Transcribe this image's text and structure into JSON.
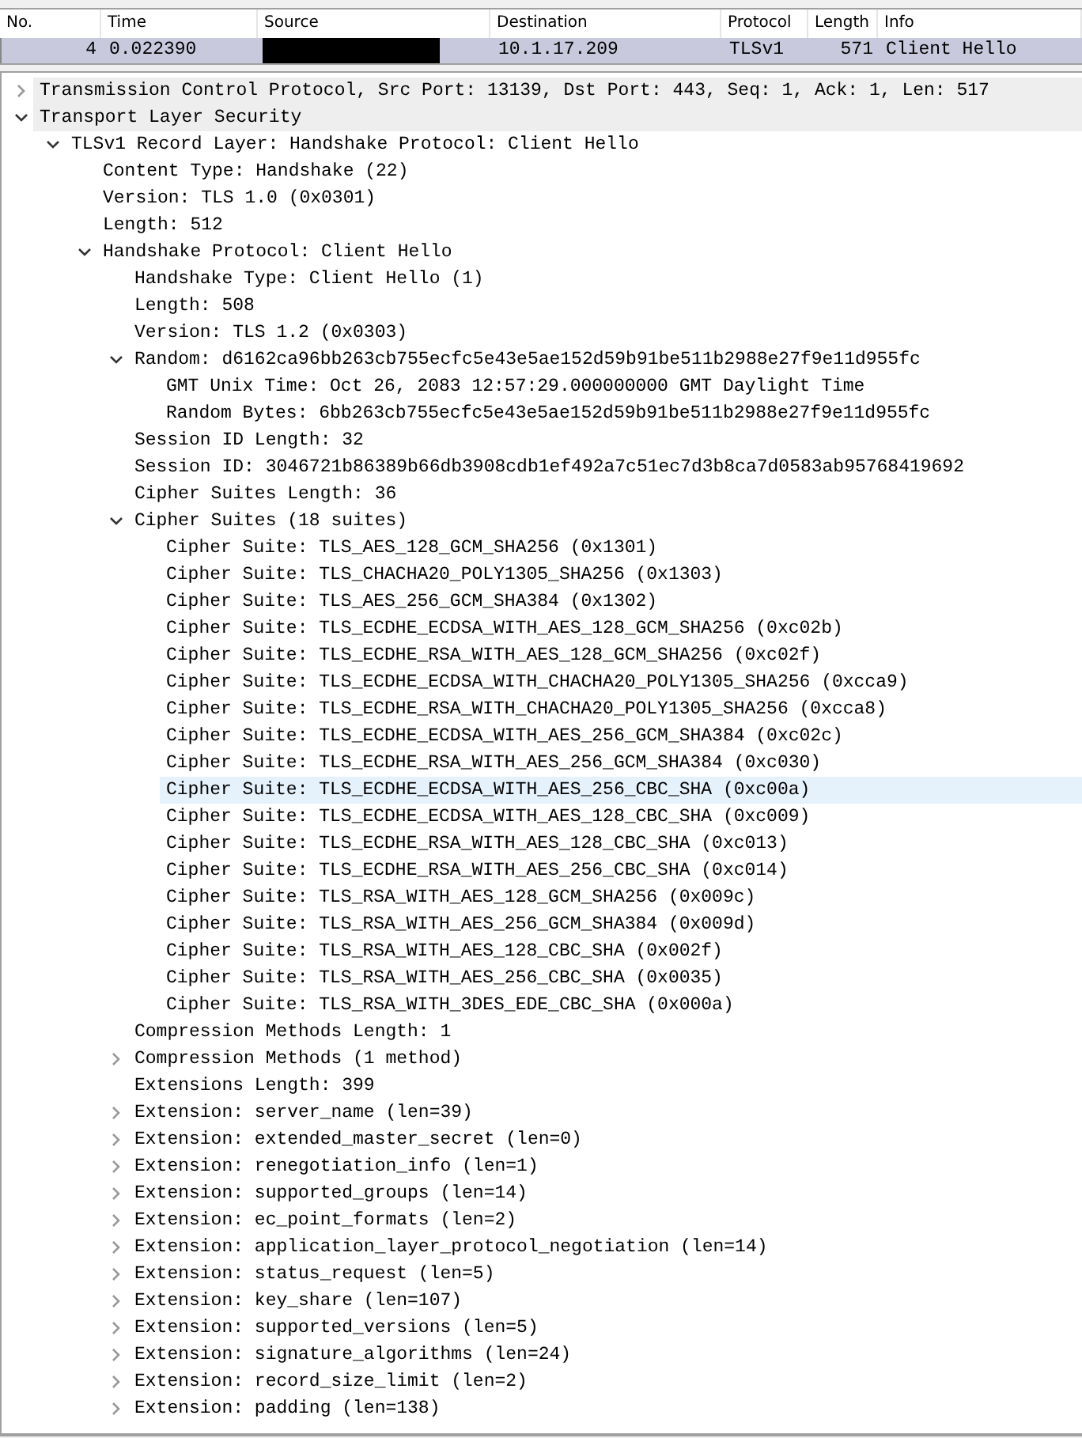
{
  "packet_list": {
    "columns": [
      "No.",
      "Time",
      "Source",
      "Destination",
      "Protocol",
      "Length",
      "Info"
    ],
    "rows": [
      {
        "selected": true,
        "number": "4",
        "time": "0.022390",
        "source_redacted": true,
        "destination": "10.1.17.209",
        "protocol": "TLSv1",
        "length": "571",
        "info": "Client Hello"
      }
    ]
  },
  "details": [
    {
      "label": "Transmission Control Protocol, Src Port: 13139, Dst Port: 443, Seq: 1, Ack: 1, Len: 517",
      "expanded": false,
      "shaded": true
    },
    {
      "label": "Transport Layer Security",
      "expanded": true,
      "shaded": true,
      "children": [
        {
          "label": "TLSv1 Record Layer: Handshake Protocol: Client Hello",
          "expanded": true,
          "children": [
            {
              "label": "Content Type: Handshake (22)"
            },
            {
              "label": "Version: TLS 1.0 (0x0301)"
            },
            {
              "label": "Length: 512"
            },
            {
              "label": "Handshake Protocol: Client Hello",
              "expanded": true,
              "children": [
                {
                  "label": "Handshake Type: Client Hello (1)"
                },
                {
                  "label": "Length: 508"
                },
                {
                  "label": "Version: TLS 1.2 (0x0303)"
                },
                {
                  "label": "Random: d6162ca96bb263cb755ecfc5e43e5ae152d59b91be511b2988e27f9e11d955fc",
                  "expanded": true,
                  "children": [
                    {
                      "label": "GMT Unix Time: Oct 26, 2083 12:57:29.000000000 GMT Daylight Time"
                    },
                    {
                      "label": "Random Bytes: 6bb263cb755ecfc5e43e5ae152d59b91be511b2988e27f9e11d955fc"
                    }
                  ]
                },
                {
                  "label": "Session ID Length: 32"
                },
                {
                  "label": "Session ID: 3046721b86389b66db3908cdb1ef492a7c51ec7d3b8ca7d0583ab95768419692"
                },
                {
                  "label": "Cipher Suites Length: 36"
                },
                {
                  "label": "Cipher Suites (18 suites)",
                  "expanded": true,
                  "children": [
                    {
                      "label": "Cipher Suite: TLS_AES_128_GCM_SHA256 (0x1301)",
                      "hovered": false
                    },
                    {
                      "label": "Cipher Suite: TLS_CHACHA20_POLY1305_SHA256 (0x1303)",
                      "hovered": false
                    },
                    {
                      "label": "Cipher Suite: TLS_AES_256_GCM_SHA384 (0x1302)",
                      "hovered": false
                    },
                    {
                      "label": "Cipher Suite: TLS_ECDHE_ECDSA_WITH_AES_128_GCM_SHA256 (0xc02b)",
                      "hovered": false
                    },
                    {
                      "label": "Cipher Suite: TLS_ECDHE_RSA_WITH_AES_128_GCM_SHA256 (0xc02f)",
                      "hovered": false
                    },
                    {
                      "label": "Cipher Suite: TLS_ECDHE_ECDSA_WITH_CHACHA20_POLY1305_SHA256 (0xcca9)",
                      "hovered": false
                    },
                    {
                      "label": "Cipher Suite: TLS_ECDHE_RSA_WITH_CHACHA20_POLY1305_SHA256 (0xcca8)",
                      "hovered": false
                    },
                    {
                      "label": "Cipher Suite: TLS_ECDHE_ECDSA_WITH_AES_256_GCM_SHA384 (0xc02c)",
                      "hovered": false
                    },
                    {
                      "label": "Cipher Suite: TLS_ECDHE_RSA_WITH_AES_256_GCM_SHA384 (0xc030)",
                      "hovered": false
                    },
                    {
                      "label": "Cipher Suite: TLS_ECDHE_ECDSA_WITH_AES_256_CBC_SHA (0xc00a)",
                      "hovered": true
                    },
                    {
                      "label": "Cipher Suite: TLS_ECDHE_ECDSA_WITH_AES_128_CBC_SHA (0xc009)",
                      "hovered": false
                    },
                    {
                      "label": "Cipher Suite: TLS_ECDHE_RSA_WITH_AES_128_CBC_SHA (0xc013)",
                      "hovered": false
                    },
                    {
                      "label": "Cipher Suite: TLS_ECDHE_RSA_WITH_AES_256_CBC_SHA (0xc014)",
                      "hovered": false
                    },
                    {
                      "label": "Cipher Suite: TLS_RSA_WITH_AES_128_GCM_SHA256 (0x009c)",
                      "hovered": false
                    },
                    {
                      "label": "Cipher Suite: TLS_RSA_WITH_AES_256_GCM_SHA384 (0x009d)",
                      "hovered": false
                    },
                    {
                      "label": "Cipher Suite: TLS_RSA_WITH_AES_128_CBC_SHA (0x002f)",
                      "hovered": false
                    },
                    {
                      "label": "Cipher Suite: TLS_RSA_WITH_AES_256_CBC_SHA (0x0035)",
                      "hovered": false
                    },
                    {
                      "label": "Cipher Suite: TLS_RSA_WITH_3DES_EDE_CBC_SHA (0x000a)",
                      "hovered": false
                    }
                  ]
                },
                {
                  "label": "Compression Methods Length: 1"
                },
                {
                  "label": "Compression Methods (1 method)",
                  "expanded": false
                },
                {
                  "label": "Extensions Length: 399"
                },
                {
                  "label": "Extension: server_name (len=39)",
                  "expanded": false
                },
                {
                  "label": "Extension: extended_master_secret (len=0)",
                  "expanded": false
                },
                {
                  "label": "Extension: renegotiation_info (len=1)",
                  "expanded": false
                },
                {
                  "label": "Extension: supported_groups (len=14)",
                  "expanded": false
                },
                {
                  "label": "Extension: ec_point_formats (len=2)",
                  "expanded": false
                },
                {
                  "label": "Extension: application_layer_protocol_negotiation (len=14)",
                  "expanded": false
                },
                {
                  "label": "Extension: status_request (len=5)",
                  "expanded": false
                },
                {
                  "label": "Extension: key_share (len=107)",
                  "expanded": false
                },
                {
                  "label": "Extension: supported_versions (len=5)",
                  "expanded": false
                },
                {
                  "label": "Extension: signature_algorithms (len=24)",
                  "expanded": false
                },
                {
                  "label": "Extension: record_size_limit (len=2)",
                  "expanded": false
                },
                {
                  "label": "Extension: padding (len=138)",
                  "expanded": false
                }
              ]
            }
          ]
        }
      ]
    }
  ]
}
